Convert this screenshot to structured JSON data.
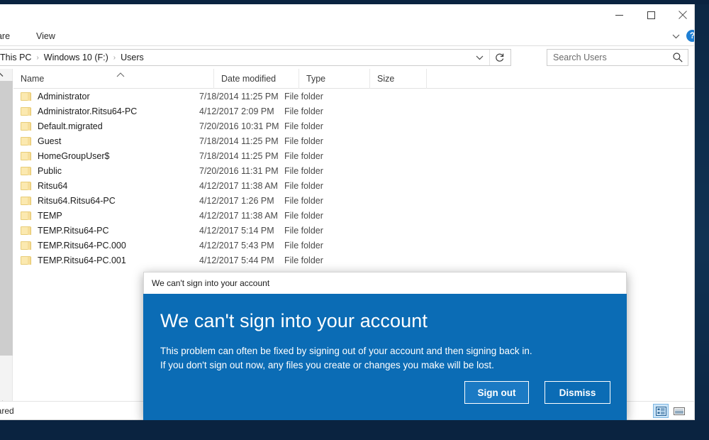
{
  "window": {
    "controls": {
      "minimize": "minimize-button",
      "maximize": "maximize-button",
      "close": "close-button"
    },
    "help_label": "?"
  },
  "ribbon": {
    "tabs": [
      {
        "label": "hare",
        "name": "ribbon-tab-share"
      },
      {
        "label": "View",
        "name": "ribbon-tab-view"
      }
    ]
  },
  "address": {
    "breadcrumb": [
      "This PC",
      "Windows 10 (F:)",
      "Users"
    ],
    "separator": "›"
  },
  "search": {
    "placeholder": "Search Users",
    "value": ""
  },
  "columns": {
    "name": "Name",
    "date_modified": "Date modified",
    "type": "Type",
    "size": "Size",
    "sort_column": "Name",
    "sort_direction": "ascending"
  },
  "files": [
    {
      "name": "Administrator",
      "date": "7/18/2014 11:25 PM",
      "type": "File folder",
      "size": ""
    },
    {
      "name": "Administrator.Ritsu64-PC",
      "date": "4/12/2017 2:09 PM",
      "type": "File folder",
      "size": ""
    },
    {
      "name": "Default.migrated",
      "date": "7/20/2016 10:31 PM",
      "type": "File folder",
      "size": ""
    },
    {
      "name": "Guest",
      "date": "7/18/2014 11:25 PM",
      "type": "File folder",
      "size": ""
    },
    {
      "name": "HomeGroupUser$",
      "date": "7/18/2014 11:25 PM",
      "type": "File folder",
      "size": ""
    },
    {
      "name": "Public",
      "date": "7/20/2016 11:31 PM",
      "type": "File folder",
      "size": ""
    },
    {
      "name": "Ritsu64",
      "date": "4/12/2017 11:38 AM",
      "type": "File folder",
      "size": ""
    },
    {
      "name": "Ritsu64.Ritsu64-PC",
      "date": "4/12/2017 1:26 PM",
      "type": "File folder",
      "size": ""
    },
    {
      "name": "TEMP",
      "date": "4/12/2017 11:38 AM",
      "type": "File folder",
      "size": ""
    },
    {
      "name": "TEMP.Ritsu64-PC",
      "date": "4/12/2017 5:14 PM",
      "type": "File folder",
      "size": ""
    },
    {
      "name": "TEMP.Ritsu64-PC.000",
      "date": "4/12/2017 5:43 PM",
      "type": "File folder",
      "size": ""
    },
    {
      "name": "TEMP.Ritsu64-PC.001",
      "date": "4/12/2017 5:44 PM",
      "type": "File folder",
      "size": ""
    }
  ],
  "status": {
    "text": "hared"
  },
  "view_modes": {
    "details": "details-view-button",
    "large_icons": "large-icons-view-button",
    "selected": "details"
  },
  "dialog": {
    "title": "We can't sign into your account",
    "heading": "We can't sign into your account",
    "message_line1": "This problem can often be fixed by signing out of your account and then signing back in.",
    "message_line2": "If you don't sign out now, any files you create or changes you make will be lost.",
    "primary_button": "Sign out",
    "secondary_button": "Dismiss",
    "accent_color": "#0b6cb5",
    "primary_button_color": "#1b7ac4"
  }
}
